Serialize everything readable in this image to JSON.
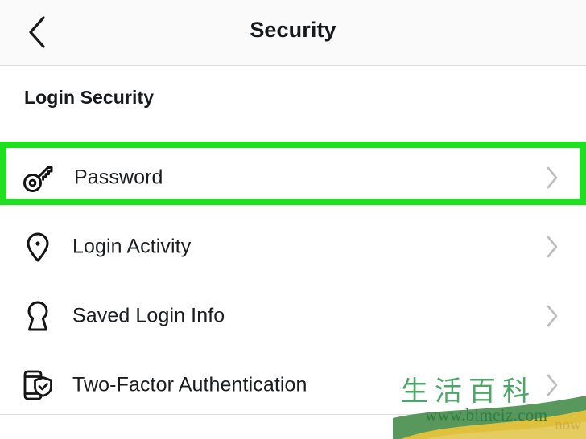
{
  "header": {
    "title": "Security",
    "back_icon": "chevron-left-icon"
  },
  "section": {
    "title": "Login Security"
  },
  "rows": [
    {
      "label": "Password",
      "icon": "key-icon",
      "chevron": "chevron-right-icon",
      "highlighted": true
    },
    {
      "label": "Login Activity",
      "icon": "location-pin-icon",
      "chevron": "chevron-right-icon",
      "highlighted": false
    },
    {
      "label": "Saved Login Info",
      "icon": "keyhole-icon",
      "chevron": "chevron-right-icon",
      "highlighted": false
    },
    {
      "label": "Two-Factor Authentication",
      "icon": "phone-shield-check-icon",
      "chevron": "chevron-right-icon",
      "highlighted": false
    }
  ],
  "watermark": {
    "cjk_text": "生活百科",
    "url": "www.bimeiz.com",
    "faint_text": "now"
  },
  "colors": {
    "highlight_green": "#1fe01f",
    "watermark_green": "#3f9e5c",
    "watermark_url_green": "#2f7d46",
    "ribbon_yellow": "#e8c33c",
    "text_primary": "#1b1c1e",
    "chevron_gray": "#bdbdbd",
    "navbar_bg": "#fafafa",
    "divider": "#dcdcdc"
  }
}
